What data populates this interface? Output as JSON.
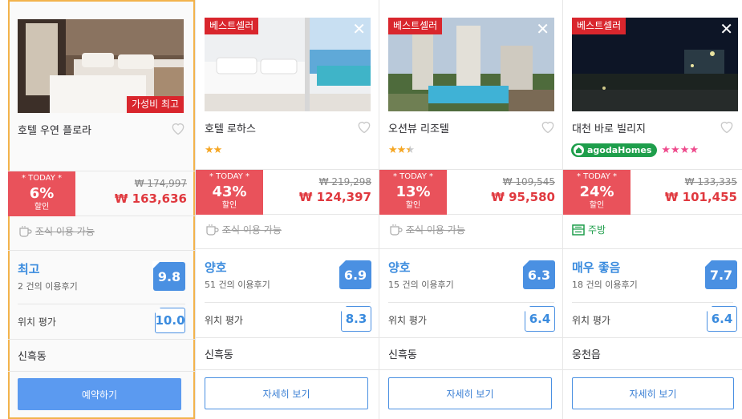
{
  "colors": {
    "best_badge": "#d9262d",
    "discount": "#e9525b",
    "price": "#e0393f",
    "score": "#4a90e2",
    "selected_border": "#f3b34c",
    "agoda_green": "#1e9e4b"
  },
  "hotels": [
    {
      "name": "호텔 우연 플로라",
      "badge": "가성비 최고",
      "stars": 0,
      "today": "* TODAY *",
      "discount": "6%",
      "discount_suffix": "할인",
      "original_price": "₩ 174,997",
      "price": "₩ 163,636",
      "amenity": "조식 이용 가능",
      "review_label": "최고",
      "review_count": "2 건의 이용후기",
      "score": "9.8",
      "location_label": "위치 평가",
      "location_score": "10.0",
      "area": "신흑동",
      "button": "예약하기"
    },
    {
      "name": "호텔 로하스",
      "badge": "베스트셀러",
      "stars": 2,
      "today": "* TODAY *",
      "discount": "43%",
      "discount_suffix": "할인",
      "original_price": "₩ 219,298",
      "price": "₩ 124,397",
      "amenity": "조식 이용 가능",
      "review_label": "양호",
      "review_count": "51 건의 이용후기",
      "score": "6.9",
      "location_label": "위치 평가",
      "location_score": "8.3",
      "area": "신흑동",
      "button": "자세히 보기"
    },
    {
      "name": "오션뷰 리조텔",
      "badge": "베스트셀러",
      "stars": 2.5,
      "today": "* TODAY *",
      "discount": "13%",
      "discount_suffix": "할인",
      "original_price": "₩ 109,545",
      "price": "₩ 95,580",
      "amenity": "조식 이용 가능",
      "review_label": "양호",
      "review_count": "15 건의 이용후기",
      "score": "6.3",
      "location_label": "위치 평가",
      "location_score": "6.4",
      "area": "신흑동",
      "button": "자세히 보기"
    },
    {
      "name": "대천 바로 빌리지",
      "badge": "베스트셀러",
      "agoda_label": "agodaHomes",
      "pink_stars": 4,
      "today": "* TODAY *",
      "discount": "24%",
      "discount_suffix": "할인",
      "original_price": "₩ 133,335",
      "price": "₩ 101,455",
      "amenity": "주방",
      "review_label": "매우 좋음",
      "review_count": "18 건의 이용후기",
      "score": "7.7",
      "location_label": "위치 평가",
      "location_score": "6.4",
      "area": "웅천읍",
      "button": "자세히 보기"
    }
  ]
}
